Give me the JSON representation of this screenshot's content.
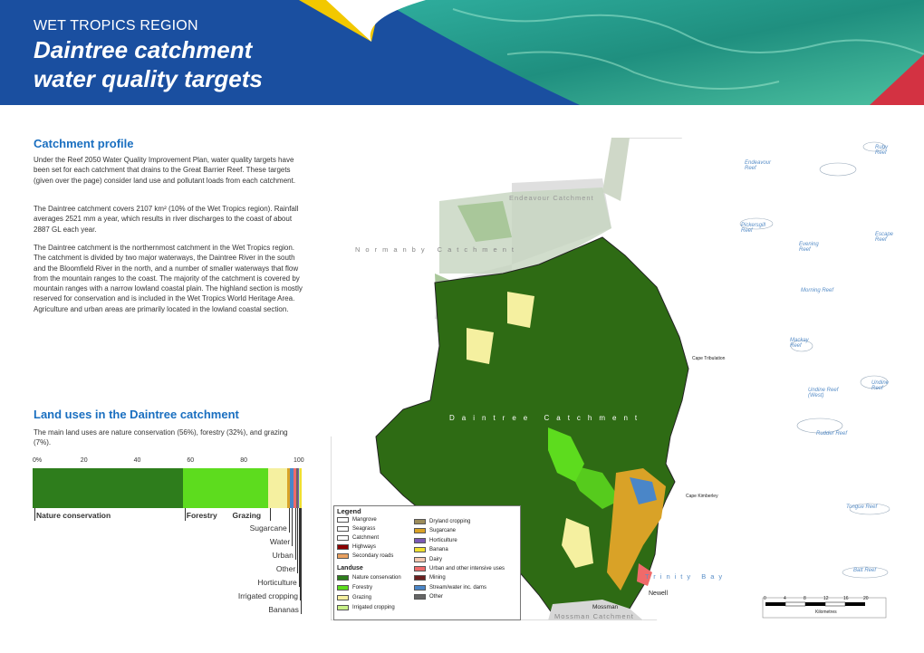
{
  "header": {
    "region": "WET TROPICS REGION",
    "title_line1": "Daintree catchment",
    "title_line2": "water quality targets"
  },
  "profile": {
    "heading": "Catchment profile",
    "p1": "Under the Reef 2050 Water Quality Improvement Plan, water quality targets have been set for each catchment that drains to the Great Barrier Reef. These targets (given over the page) consider land use and pollutant loads from each catchment.",
    "p2": "The Daintree catchment covers 2107 km² (10% of the Wet Tropics region). Rainfall averages 2521 mm a year, which results in river discharges to the coast of about 2887 GL each year.",
    "p3": "The Daintree catchment is the northernmost catchment in the Wet Tropics region. The catchment is divided by two major waterways, the Daintree River in the south and the Bloomfield River in the north, and a number of smaller waterways that flow from the mountain ranges to the coast. The majority of the catchment is covered by mountain ranges with a narrow lowland coastal plain. The highland section is mostly reserved for conservation and is included in the Wet Tropics World Heritage Area. Agriculture and urban areas are primarily located in the lowland coastal section."
  },
  "landuse": {
    "heading": "Land uses in the Daintree catchment",
    "text": "The main land uses are nature conservation (56%), forestry (32%), and grazing (7%).",
    "axis_ticks": [
      "0%",
      "20",
      "40",
      "60",
      "80",
      "100"
    ]
  },
  "chart_data": {
    "type": "bar",
    "orientation": "horizontal-stacked",
    "xlim": [
      0,
      100
    ],
    "series": [
      {
        "name": "Nature conservation",
        "value": 56,
        "color": "#2e7d1c"
      },
      {
        "name": "Forestry",
        "value": 32,
        "color": "#5ddc1e"
      },
      {
        "name": "Grazing",
        "value": 7,
        "color": "#f5f0a0"
      },
      {
        "name": "Sugarcane",
        "value": 1,
        "color": "#d9a227"
      },
      {
        "name": "Water",
        "value": 1.4,
        "color": "#4a86c8"
      },
      {
        "name": "Urban",
        "value": 1,
        "color": "#f06a6a"
      },
      {
        "name": "Other",
        "value": 0.6,
        "color": "#666666"
      },
      {
        "name": "Horticulture",
        "value": 0.4,
        "color": "#7a5ab5"
      },
      {
        "name": "Irrigated cropping",
        "value": 0.3,
        "color": "#c8f088"
      },
      {
        "name": "Bananas",
        "value": 0.3,
        "color": "#f0e030"
      }
    ]
  },
  "legend": {
    "title": "Legend",
    "landuse_title": "Landuse",
    "left_items": [
      {
        "label": "Mangrove",
        "color": "#ffffff"
      },
      {
        "label": "Seagrass",
        "color": "#ffffff"
      },
      {
        "label": "Catchment",
        "color": "#ffffff"
      },
      {
        "label": "Highways",
        "color": "#8b0000"
      },
      {
        "label": "Secondary roads",
        "color": "#e8a060"
      }
    ],
    "landuse_items": [
      {
        "label": "Nature conservation",
        "color": "#2e7d1c"
      },
      {
        "label": "Forestry",
        "color": "#5ddc1e"
      },
      {
        "label": "Grazing",
        "color": "#f5f0a0"
      },
      {
        "label": "Irrigated cropping",
        "color": "#c8f088"
      }
    ],
    "right_items": [
      {
        "label": "Dryland cropping",
        "color": "#9c8c5a"
      },
      {
        "label": "Sugarcane",
        "color": "#d9a227"
      },
      {
        "label": "Horticulture",
        "color": "#7a5ab5"
      },
      {
        "label": "Banana",
        "color": "#f0e030"
      },
      {
        "label": "Dairy",
        "color": "#f5c8b0"
      },
      {
        "label": "Urban and other intensive uses",
        "color": "#f06a6a"
      },
      {
        "label": "Mining",
        "color": "#6b1f1f"
      },
      {
        "label": "Stream/water inc. dams",
        "color": "#4a86c8"
      },
      {
        "label": "Other",
        "color": "#666666"
      }
    ]
  },
  "map": {
    "catchments": {
      "endeavour": "Endeavour Catchment",
      "normanby": "Normanby Catchment",
      "daintree": "Daintree Catchment",
      "mossman": "Mossman Catchment"
    },
    "places": {
      "cape_tribulation": "Cape Tribulation",
      "cape_kimberley": "Cape Kimberley",
      "newell": "Newell",
      "mossman": "Mossman",
      "trinity_bay": "Trinity Bay"
    },
    "reefs": [
      "Ruby Reef",
      "Endeavour Reef",
      "Pickersgill Reef",
      "Escape Reef",
      "Evening Reef",
      "Mackay Reef",
      "Undine Reef",
      "Undine Reef (West)",
      "Rudder Reef",
      "Tongue Reef",
      "Batt Reef",
      "Morning Reef"
    ],
    "scale": {
      "ticks": [
        "0",
        "4",
        "8",
        "12",
        "16",
        "20"
      ],
      "unit": "Kilometres"
    }
  }
}
